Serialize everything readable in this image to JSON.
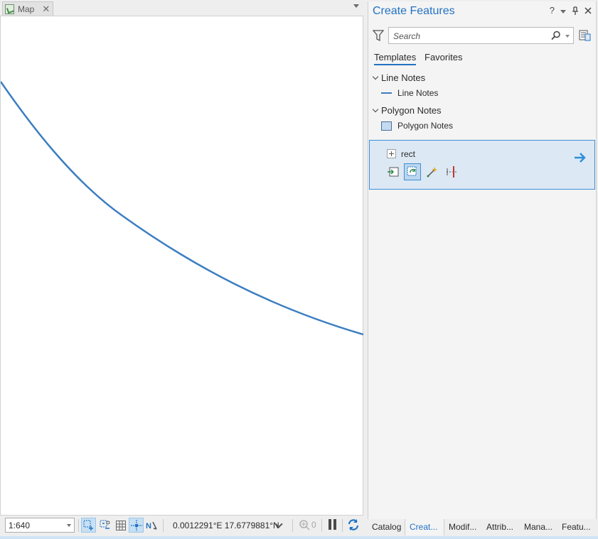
{
  "map_view": {
    "tab_label": "Map",
    "tab_close_glyph": "✕",
    "icon": "map-document-icon"
  },
  "status_bar": {
    "scale_value": "1:640",
    "coordinates": "0.0012291°E 17.6779881°N",
    "selected_count": "0",
    "icons": [
      "fixed-zoom-in-icon",
      "fixed-zoom-out-icon",
      "grid-icon",
      "snapping-icon",
      "north-arrow-icon",
      "selection-icon",
      "pause-icon",
      "refresh-icon"
    ]
  },
  "create_features": {
    "title": "Create Features",
    "help_glyph": "?",
    "search_placeholder": "Search",
    "tabs": {
      "templates": "Templates",
      "favorites": "Favorites"
    },
    "groups": [
      {
        "name": "Line Notes",
        "items": [
          {
            "label": "Line Notes",
            "swatch": "line"
          }
        ]
      },
      {
        "name": "Polygon Notes",
        "items": [
          {
            "label": "Polygon Notes",
            "swatch": "polygon"
          }
        ]
      }
    ],
    "selected_template": {
      "label": "rect",
      "tools": [
        "rectangle-tool-icon",
        "autocomplete-polygon-icon",
        "trace-tool-icon",
        "split-tool-icon"
      ],
      "active_tool_index": 1
    }
  },
  "dock_tabs": [
    {
      "label": "Catalog",
      "active": false
    },
    {
      "label": "Creat...",
      "active": true
    },
    {
      "label": "Modif...",
      "active": false
    },
    {
      "label": "Attrib...",
      "active": false
    },
    {
      "label": "Mana...",
      "active": false
    },
    {
      "label": "Featu...",
      "active": false
    }
  ],
  "colors": {
    "accent": "#2272c3",
    "map_line": "#3c7ec0",
    "selected_bg": "#dce8f4"
  }
}
